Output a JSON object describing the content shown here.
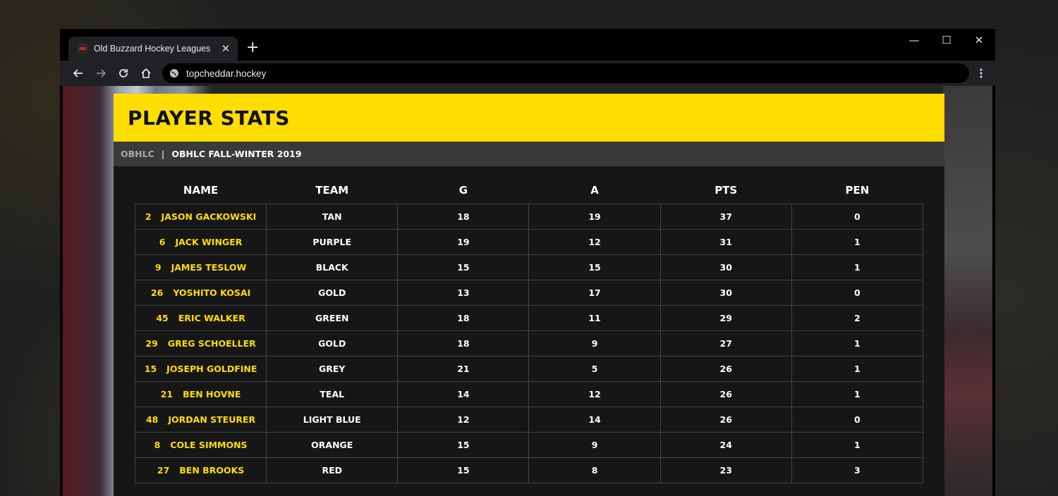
{
  "browser": {
    "tab_title": "Old Buzzard Hockey Leagues",
    "tab_close": "✕",
    "new_tab": "+",
    "url": "topcheddar.hockey"
  },
  "window_controls": {
    "minimize": "—",
    "maximize": "☐",
    "close": "✕"
  },
  "page": {
    "title": "PLAYER STATS",
    "breadcrumb": {
      "league": "OBHLC",
      "separator": "|",
      "season": "OBHLC FALL-WINTER 2019"
    }
  },
  "colors": {
    "accent": "#ffde00",
    "page_bg": "#161616",
    "breadcrumb_bg": "#3a3a3a"
  },
  "stats": {
    "headers": [
      "NAME",
      "TEAM",
      "G",
      "A",
      "PTS",
      "PEN"
    ],
    "rows": [
      {
        "number": "2",
        "name": "JASON GACKOWSKI",
        "team": "TAN",
        "g": "18",
        "a": "19",
        "pts": "37",
        "pen": "0"
      },
      {
        "number": "6",
        "name": "JACK WINGER",
        "team": "PURPLE",
        "g": "19",
        "a": "12",
        "pts": "31",
        "pen": "1"
      },
      {
        "number": "9",
        "name": "JAMES TESLOW",
        "team": "BLACK",
        "g": "15",
        "a": "15",
        "pts": "30",
        "pen": "1"
      },
      {
        "number": "26",
        "name": "YOSHITO KOSAI",
        "team": "GOLD",
        "g": "13",
        "a": "17",
        "pts": "30",
        "pen": "0"
      },
      {
        "number": "45",
        "name": "ERIC WALKER",
        "team": "GREEN",
        "g": "18",
        "a": "11",
        "pts": "29",
        "pen": "2"
      },
      {
        "number": "29",
        "name": "GREG SCHOELLER",
        "team": "GOLD",
        "g": "18",
        "a": "9",
        "pts": "27",
        "pen": "1"
      },
      {
        "number": "15",
        "name": "JOSEPH GOLDFINE",
        "team": "GREY",
        "g": "21",
        "a": "5",
        "pts": "26",
        "pen": "1"
      },
      {
        "number": "21",
        "name": "BEN HOVNE",
        "team": "TEAL",
        "g": "14",
        "a": "12",
        "pts": "26",
        "pen": "1"
      },
      {
        "number": "48",
        "name": "JORDAN STEURER",
        "team": "LIGHT BLUE",
        "g": "12",
        "a": "14",
        "pts": "26",
        "pen": "0"
      },
      {
        "number": "8",
        "name": "COLE SIMMONS",
        "team": "ORANGE",
        "g": "15",
        "a": "9",
        "pts": "24",
        "pen": "1"
      },
      {
        "number": "27",
        "name": "BEN BROOKS",
        "team": "RED",
        "g": "15",
        "a": "8",
        "pts": "23",
        "pen": "3"
      }
    ]
  }
}
